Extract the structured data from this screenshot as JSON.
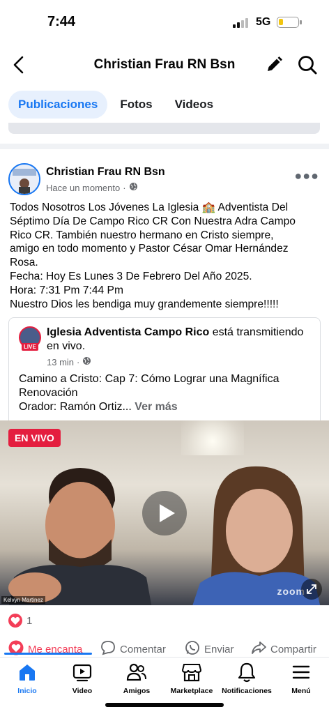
{
  "status_bar": {
    "time": "7:44",
    "network": "5G",
    "battery_color": "#f2c50f"
  },
  "header": {
    "title": "Christian Frau RN Bsn",
    "icons": [
      "back-icon",
      "edit-icon",
      "search-icon"
    ]
  },
  "tabs": [
    {
      "label": "Publicaciones",
      "active": true
    },
    {
      "label": "Fotos",
      "active": false
    },
    {
      "label": "Videos",
      "active": false
    }
  ],
  "post": {
    "author": "Christian Frau RN Bsn",
    "time": "Hace un momento",
    "lines": [
      "Todos Nosotros Los Jóvenes La Iglesia 🏫 Adventista Del",
      "Séptimo Día De Campo Rico CR Con Nuestra Adra Campo",
      "Rico CR. También nuestro hermano en Cristo siempre,",
      "amigo en todo momento y Pastor César Omar Hernández",
      "Rosa.",
      "Fecha: Hoy Es Lunes 3 De Febrero Del Año 2025.",
      "Hora: 7:31 Pm 7:44 Pm",
      "Nuestro Dios les bendiga muy grandemente siempre!!!!!"
    ],
    "shared": {
      "page_name": "Iglesia Adventista Campo Rico",
      "action": " está transmitiendo en vivo.",
      "live_badge": "LIVE",
      "time": "13 min",
      "text_1": "Camino a Cristo: Cap 7: Cómo Lograr una Magnífica Renovación",
      "text_2": "Orador: Ramón Ortiz...",
      "see_more": " Ver más"
    },
    "video": {
      "live_label": "EN VIVO",
      "participant_name": "Kelvyn Martinez",
      "watermark": "zoom"
    },
    "reactions": {
      "count": "1"
    },
    "actions": {
      "love": "Me encanta",
      "comment": "Comentar",
      "send": "Enviar",
      "share": "Compartir"
    }
  },
  "bottom_nav": [
    {
      "label": "Inicio",
      "icon": "home-icon",
      "active": true
    },
    {
      "label": "Video",
      "icon": "video-icon",
      "active": false
    },
    {
      "label": "Amigos",
      "icon": "friends-icon",
      "active": false
    },
    {
      "label": "Marketplace",
      "icon": "marketplace-icon",
      "active": false
    },
    {
      "label": "Notificaciones",
      "icon": "bell-icon",
      "active": false
    },
    {
      "label": "Menú",
      "icon": "menu-icon",
      "active": false
    }
  ],
  "colors": {
    "accent": "#1877f2",
    "live_red": "#e41e3f",
    "love_red": "#f33e58"
  }
}
